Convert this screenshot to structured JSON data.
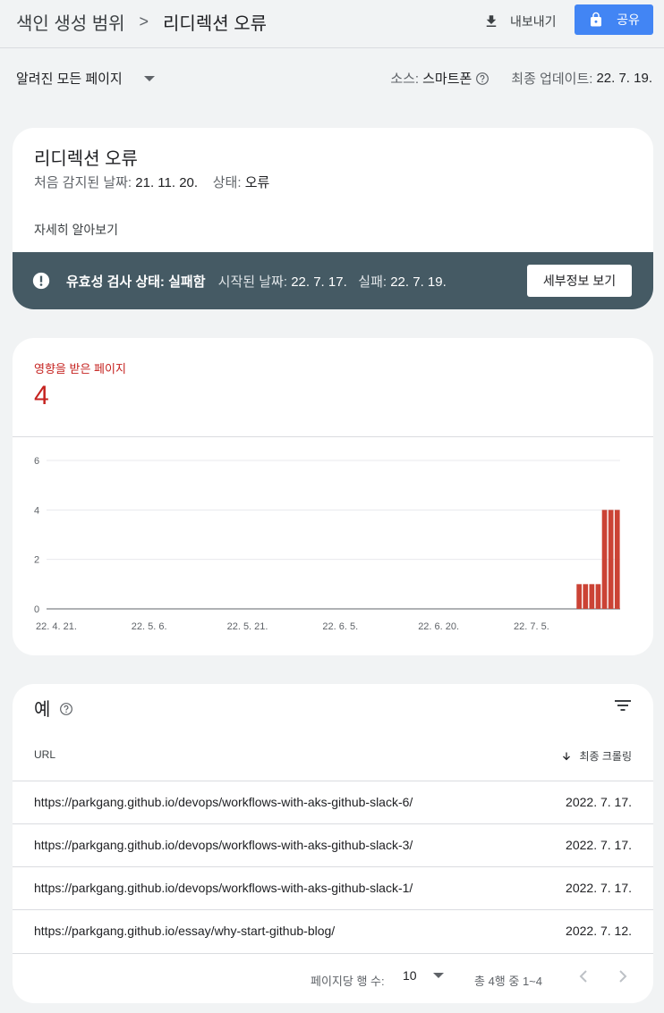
{
  "header": {
    "breadcrumb_parent": "색인 생성 범위",
    "breadcrumb_current": "리디렉션 오류",
    "export_label": "내보내기",
    "share_label": "공유"
  },
  "filterbar": {
    "filter_label": "알려진 모든 페이지",
    "source_label": "소스:",
    "source_value": "스마트폰",
    "updated_label": "최종 업데이트:",
    "updated_value": "22. 7. 19."
  },
  "issue": {
    "title": "리디렉션 오류",
    "first_detected_label": "처음 감지된 날짜:",
    "first_detected_value": "21. 11. 20.",
    "status_label": "상태:",
    "status_value": "오류",
    "learn_more": "자세히 알아보기",
    "validation_title": "유효성 검사 상태: 실패함",
    "started_label": "시작된 날짜:",
    "started_value": "22. 7. 17.",
    "failed_label": "실패:",
    "failed_value": "22. 7. 19.",
    "details_button": "세부정보 보기"
  },
  "affected": {
    "label": "영향을 받은 페이지",
    "count": "4"
  },
  "chart_data": {
    "type": "bar",
    "color": "#cb4335",
    "y_ticks": [
      0,
      2,
      4,
      6
    ],
    "ylim": [
      0,
      6
    ],
    "x_tick_labels": [
      "22. 4. 21.",
      "22. 5. 6.",
      "22. 5. 21.",
      "22. 6. 5.",
      "22. 6. 20.",
      "22. 7. 5."
    ],
    "x": [
      "2022-07-13",
      "2022-07-14",
      "2022-07-15",
      "2022-07-16",
      "2022-07-17",
      "2022-07-18",
      "2022-07-19"
    ],
    "values": [
      1,
      1,
      1,
      1,
      4,
      4,
      4
    ]
  },
  "examples": {
    "title": "예",
    "col_url": "URL",
    "col_date": "최종 크롤링",
    "rows": [
      {
        "url": "https://parkgang.github.io/devops/workflows-with-aks-github-slack-6/",
        "date": "2022. 7. 17."
      },
      {
        "url": "https://parkgang.github.io/devops/workflows-with-aks-github-slack-3/",
        "date": "2022. 7. 17."
      },
      {
        "url": "https://parkgang.github.io/devops/workflows-with-aks-github-slack-1/",
        "date": "2022. 7. 17."
      },
      {
        "url": "https://parkgang.github.io/essay/why-start-github-blog/",
        "date": "2022. 7. 12."
      }
    ],
    "rows_per_page_label": "페이지당 행 수:",
    "rows_per_page_value": "10",
    "range_label": "총 4행 중 1~4"
  }
}
